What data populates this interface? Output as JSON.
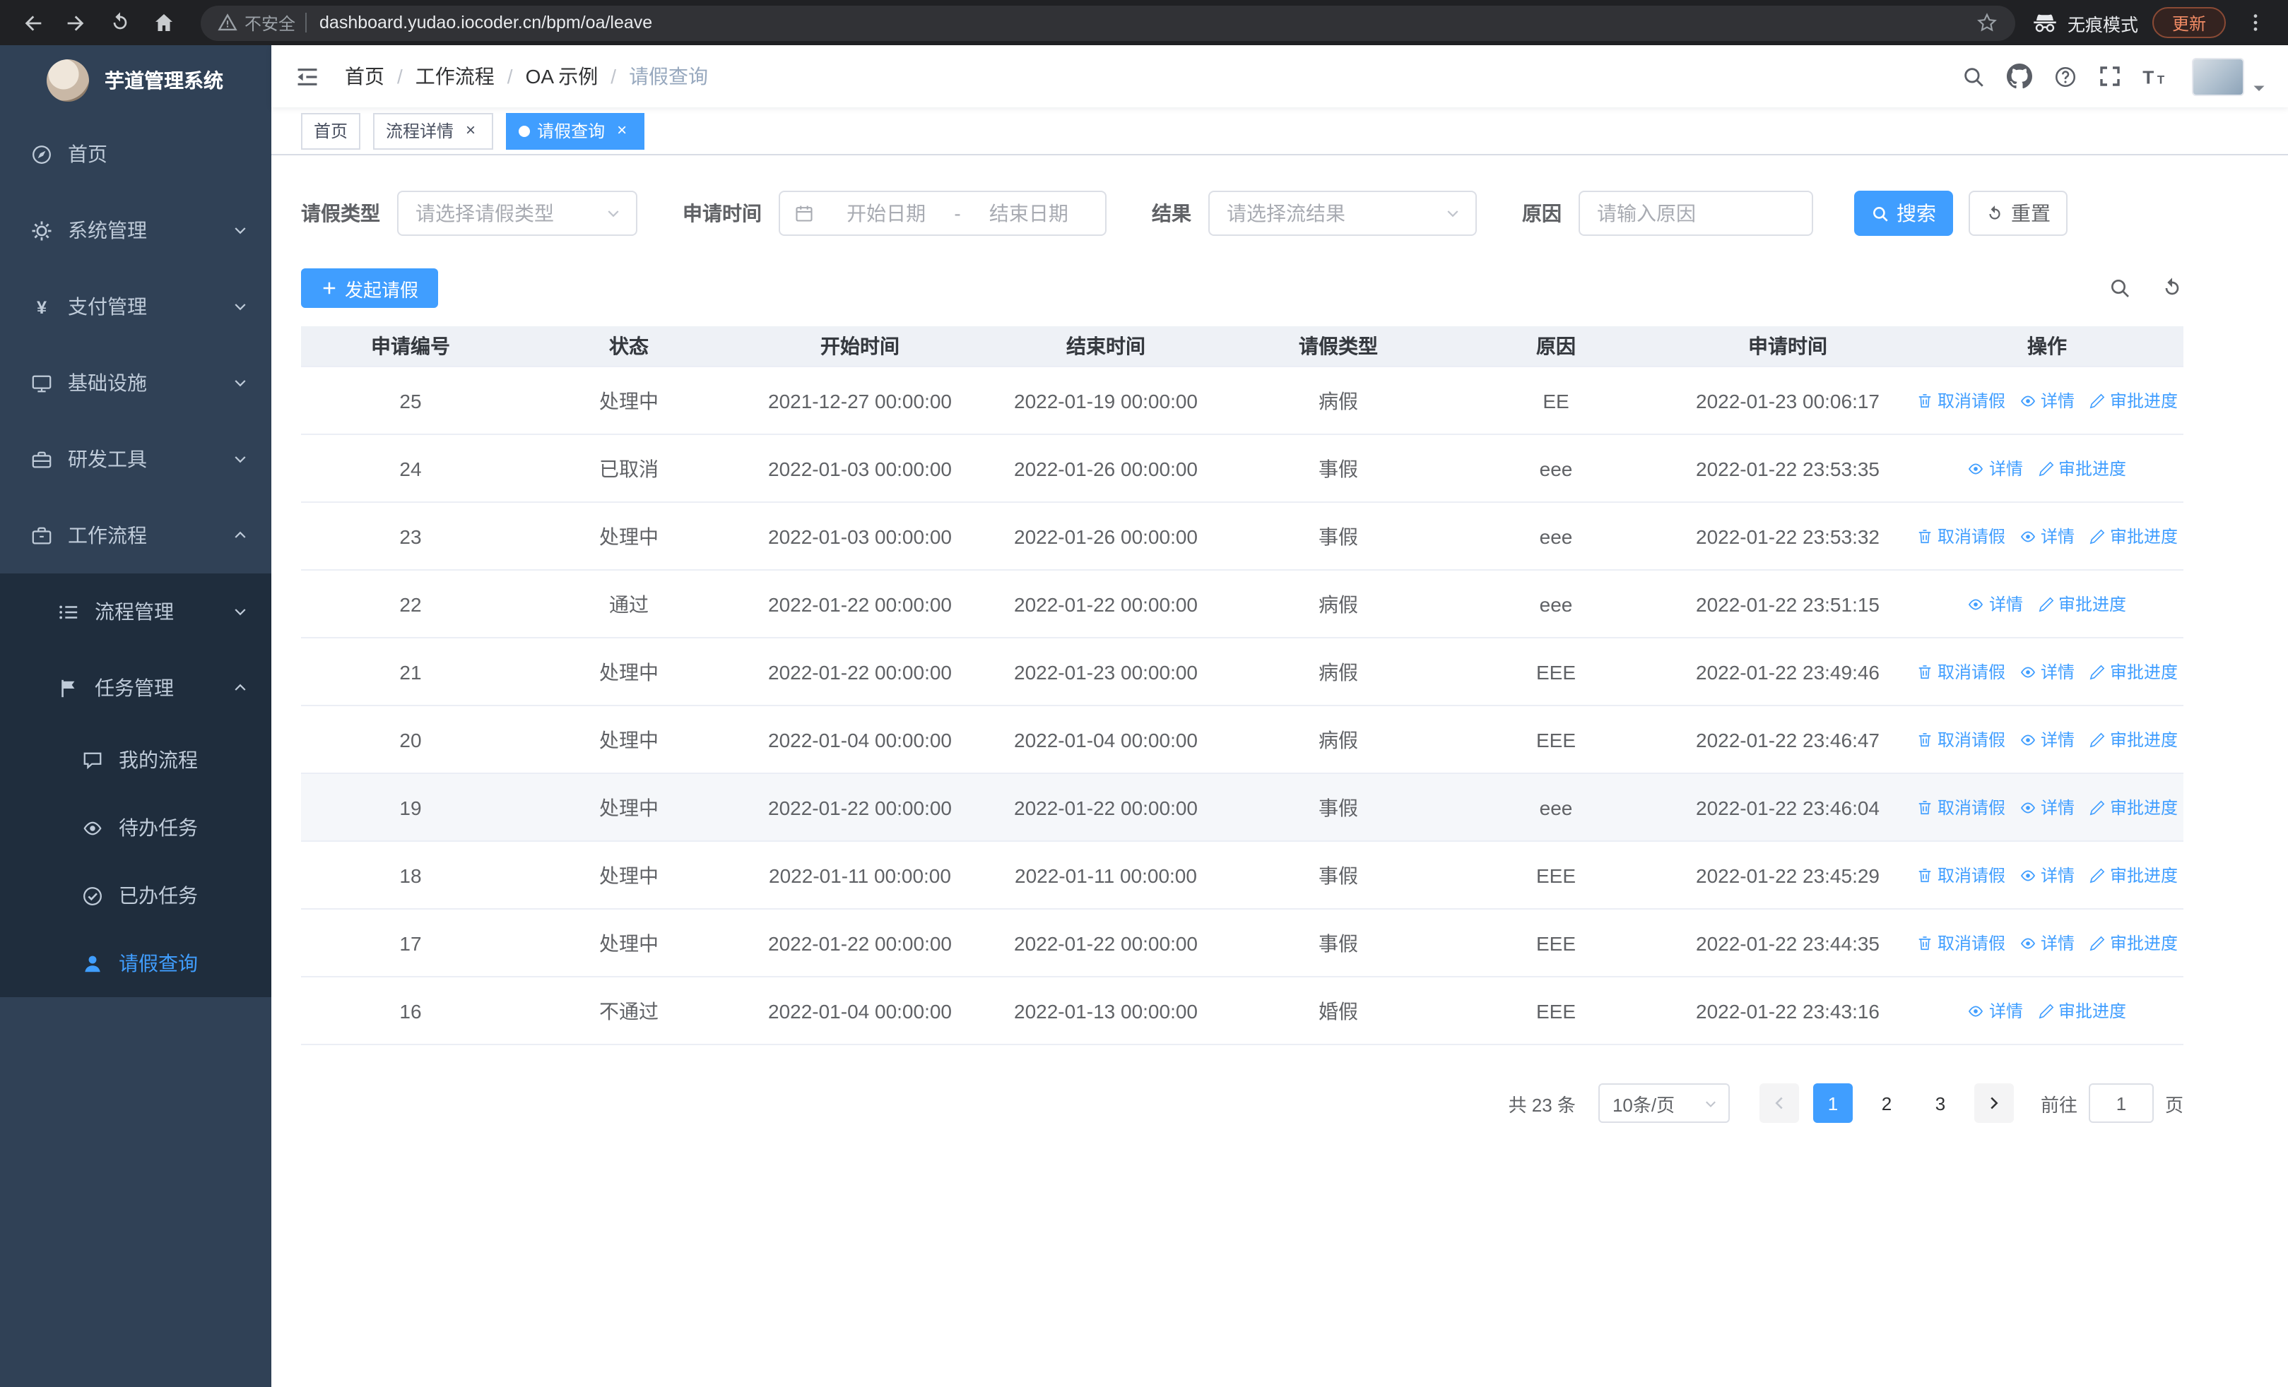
{
  "browser": {
    "security": "不安全",
    "url": "dashboard.yudao.iocoder.cn/bpm/oa/leave",
    "incognito": "无痕模式",
    "update": "更新"
  },
  "sidebar": {
    "title": "芋道管理系统",
    "menu": [
      {
        "name": "home",
        "label": "首页",
        "icon": "guide-icon",
        "level": 1
      },
      {
        "name": "system-management",
        "label": "系统管理",
        "icon": "gear-icon",
        "level": 1,
        "arrow": "down"
      },
      {
        "name": "payment-management",
        "label": "支付管理",
        "icon": "yen-icon",
        "level": 1,
        "arrow": "down"
      },
      {
        "name": "infrastructure",
        "label": "基础设施",
        "icon": "monitor-icon",
        "level": 1,
        "arrow": "down"
      },
      {
        "name": "dev-tools",
        "label": "研发工具",
        "icon": "toolbox-icon",
        "level": 1,
        "arrow": "down"
      },
      {
        "name": "workflow",
        "label": "工作流程",
        "icon": "briefcase-icon",
        "level": 1,
        "arrow": "up"
      },
      {
        "name": "process-management",
        "label": "流程管理",
        "icon": "list-icon",
        "level": 2,
        "arrow": "down"
      },
      {
        "name": "task-management",
        "label": "任务管理",
        "icon": "flag-icon",
        "level": 2,
        "arrow": "up"
      },
      {
        "name": "my-process",
        "label": "我的流程",
        "icon": "chat-icon",
        "level": 3
      },
      {
        "name": "todo-tasks",
        "label": "待办任务",
        "icon": "eye-icon",
        "level": 3
      },
      {
        "name": "done-tasks",
        "label": "已办任务",
        "icon": "check-icon",
        "level": 3
      },
      {
        "name": "leave-query",
        "label": "请假查询",
        "icon": "user-icon",
        "level": 3,
        "active": true
      }
    ]
  },
  "header": {
    "breadcrumb": [
      "首页",
      "工作流程",
      "OA 示例",
      "请假查询"
    ]
  },
  "tabs": [
    {
      "label": "首页",
      "active": false,
      "closable": false
    },
    {
      "label": "流程详情",
      "active": false,
      "closable": true
    },
    {
      "label": "请假查询",
      "active": true,
      "closable": true
    }
  ],
  "filters": {
    "leave_type": {
      "label": "请假类型",
      "placeholder": "请选择请假类型"
    },
    "apply_time": {
      "label": "申请时间",
      "start_placeholder": "开始日期",
      "separator": "-",
      "end_placeholder": "结束日期"
    },
    "result": {
      "label": "结果",
      "placeholder": "请选择流结果"
    },
    "reason": {
      "label": "原因",
      "placeholder": "请输入原因"
    },
    "search": "搜索",
    "reset": "重置"
  },
  "toolbar": {
    "create": "发起请假"
  },
  "table": {
    "columns": [
      "申请编号",
      "状态",
      "开始时间",
      "结束时间",
      "请假类型",
      "原因",
      "申请时间",
      "操作"
    ],
    "action_labels": {
      "cancel": "取消请假",
      "detail": "详情",
      "progress": "审批进度"
    },
    "rows": [
      {
        "id": "25",
        "status": "处理中",
        "start": "2021-12-27 00:00:00",
        "end": "2022-01-19 00:00:00",
        "type": "病假",
        "reason": "EE",
        "applied": "2022-01-23 00:06:17",
        "actions": [
          "cancel",
          "detail",
          "progress"
        ]
      },
      {
        "id": "24",
        "status": "已取消",
        "start": "2022-01-03 00:00:00",
        "end": "2022-01-26 00:00:00",
        "type": "事假",
        "reason": "eee",
        "applied": "2022-01-22 23:53:35",
        "actions": [
          "detail",
          "progress"
        ]
      },
      {
        "id": "23",
        "status": "处理中",
        "start": "2022-01-03 00:00:00",
        "end": "2022-01-26 00:00:00",
        "type": "事假",
        "reason": "eee",
        "applied": "2022-01-22 23:53:32",
        "actions": [
          "cancel",
          "detail",
          "progress"
        ]
      },
      {
        "id": "22",
        "status": "通过",
        "start": "2022-01-22 00:00:00",
        "end": "2022-01-22 00:00:00",
        "type": "病假",
        "reason": "eee",
        "applied": "2022-01-22 23:51:15",
        "actions": [
          "detail",
          "progress"
        ]
      },
      {
        "id": "21",
        "status": "处理中",
        "start": "2022-01-22 00:00:00",
        "end": "2022-01-23 00:00:00",
        "type": "病假",
        "reason": "EEE",
        "applied": "2022-01-22 23:49:46",
        "actions": [
          "cancel",
          "detail",
          "progress"
        ]
      },
      {
        "id": "20",
        "status": "处理中",
        "start": "2022-01-04 00:00:00",
        "end": "2022-01-04 00:00:00",
        "type": "病假",
        "reason": "EEE",
        "applied": "2022-01-22 23:46:47",
        "actions": [
          "cancel",
          "detail",
          "progress"
        ]
      },
      {
        "id": "19",
        "status": "处理中",
        "start": "2022-01-22 00:00:00",
        "end": "2022-01-22 00:00:00",
        "type": "事假",
        "reason": "eee",
        "applied": "2022-01-22 23:46:04",
        "actions": [
          "cancel",
          "detail",
          "progress"
        ],
        "hover": true
      },
      {
        "id": "18",
        "status": "处理中",
        "start": "2022-01-11 00:00:00",
        "end": "2022-01-11 00:00:00",
        "type": "事假",
        "reason": "EEE",
        "applied": "2022-01-22 23:45:29",
        "actions": [
          "cancel",
          "detail",
          "progress"
        ]
      },
      {
        "id": "17",
        "status": "处理中",
        "start": "2022-01-22 00:00:00",
        "end": "2022-01-22 00:00:00",
        "type": "事假",
        "reason": "EEE",
        "applied": "2022-01-22 23:44:35",
        "actions": [
          "cancel",
          "detail",
          "progress"
        ]
      },
      {
        "id": "16",
        "status": "不通过",
        "start": "2022-01-04 00:00:00",
        "end": "2022-01-13 00:00:00",
        "type": "婚假",
        "reason": "EEE",
        "applied": "2022-01-22 23:43:16",
        "actions": [
          "detail",
          "progress"
        ]
      }
    ]
  },
  "pagination": {
    "total": "共 23 条",
    "page_size": "10条/页",
    "pages": [
      "1",
      "2",
      "3"
    ],
    "active_page": "1",
    "goto_label": "前往",
    "goto_value": "1",
    "goto_suffix": "页"
  },
  "colors": {
    "primary": "#409eff",
    "sidebar_bg": "#304156",
    "sidebar_sub_bg": "#1f2d3d",
    "chrome_bg": "#202124"
  }
}
